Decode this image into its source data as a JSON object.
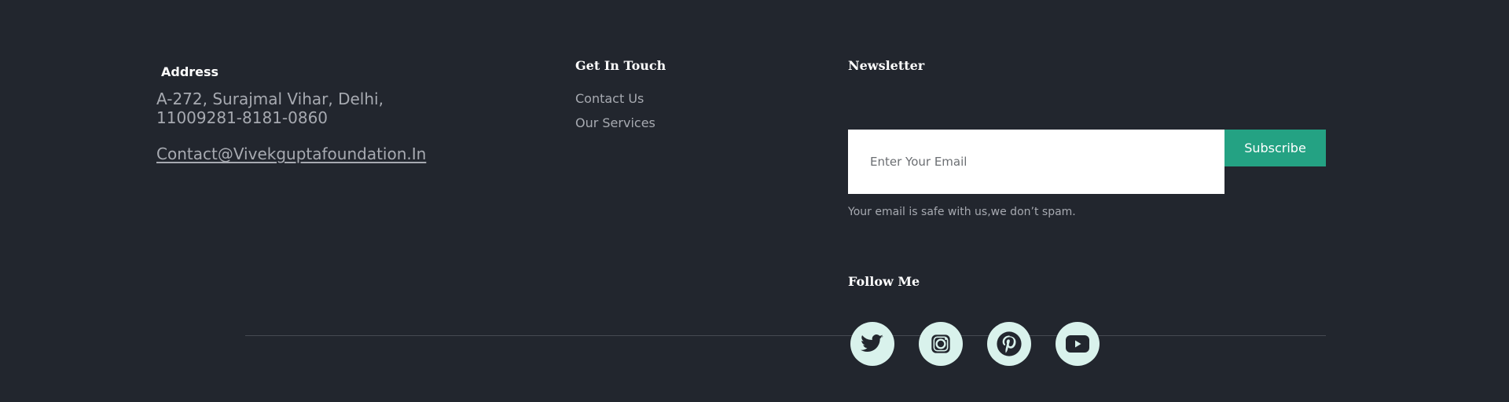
{
  "address": {
    "heading": "Address",
    "text": "A-272, Surajmal Vihar, Delhi,\n11009281-8181-0860",
    "email": "Contact@Vivekguptafoundation.In"
  },
  "touch": {
    "heading": "Get In Touch",
    "links": [
      "Contact Us",
      "Our Services"
    ]
  },
  "newsletter": {
    "heading": "Newsletter",
    "email_placeholder": "Enter Your Email",
    "subscribe_label": "Subscribe",
    "note": "Your email is safe with us,we don’t spam."
  },
  "follow": {
    "heading": "Follow Me",
    "icons": [
      "twitter-icon",
      "instagram-icon",
      "pinterest-icon",
      "youtube-icon"
    ]
  },
  "colors": {
    "background": "#22262e",
    "accent": "#24a283",
    "icon_bg": "#d9f2ec",
    "muted_text": "#a7aab1"
  }
}
